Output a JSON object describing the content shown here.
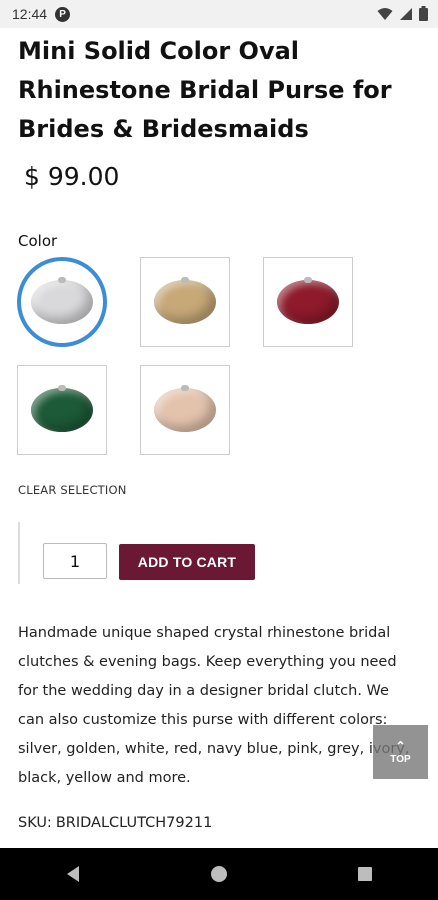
{
  "status_bar": {
    "time": "12:44",
    "app_icon_letter": "P"
  },
  "product": {
    "title": "Mini Solid Color Oval Rhinestone Bridal Purse for Brides & Bridesmaids",
    "price": "$ 99.00",
    "color_label": "Color",
    "swatches": [
      {
        "name": "silver",
        "color": "#d9d9db",
        "selected": true
      },
      {
        "name": "gold",
        "color": "#c7a877",
        "selected": false
      },
      {
        "name": "red",
        "color": "#8e1a2b",
        "selected": false
      },
      {
        "name": "green",
        "color": "#1d5a37",
        "selected": false
      },
      {
        "name": "blush",
        "color": "#e4c3ad",
        "selected": false
      }
    ],
    "clear_selection": "CLEAR SELECTION",
    "quantity": "1",
    "add_to_cart": "ADD TO CART",
    "description": "Handmade unique shaped crystal rhinestone bridal clutches & evening bags.  Keep everything you need for the wedding day in a designer bridal clutch. We can also customize this purse with different colors: silver, golden, white, red, navy blue, pink, grey, ivory, black, yellow and more.",
    "sku_label": "SKU:",
    "sku_value": "BRIDALCLUTCH79211"
  },
  "top_button": {
    "label": "TOP",
    "icon": "chevron-up-icon"
  },
  "nav": {
    "back": "back-icon",
    "home": "home-icon",
    "recents": "recents-icon"
  },
  "colors": {
    "accent": "#6b1834",
    "selected_ring": "#3d8dd6"
  }
}
